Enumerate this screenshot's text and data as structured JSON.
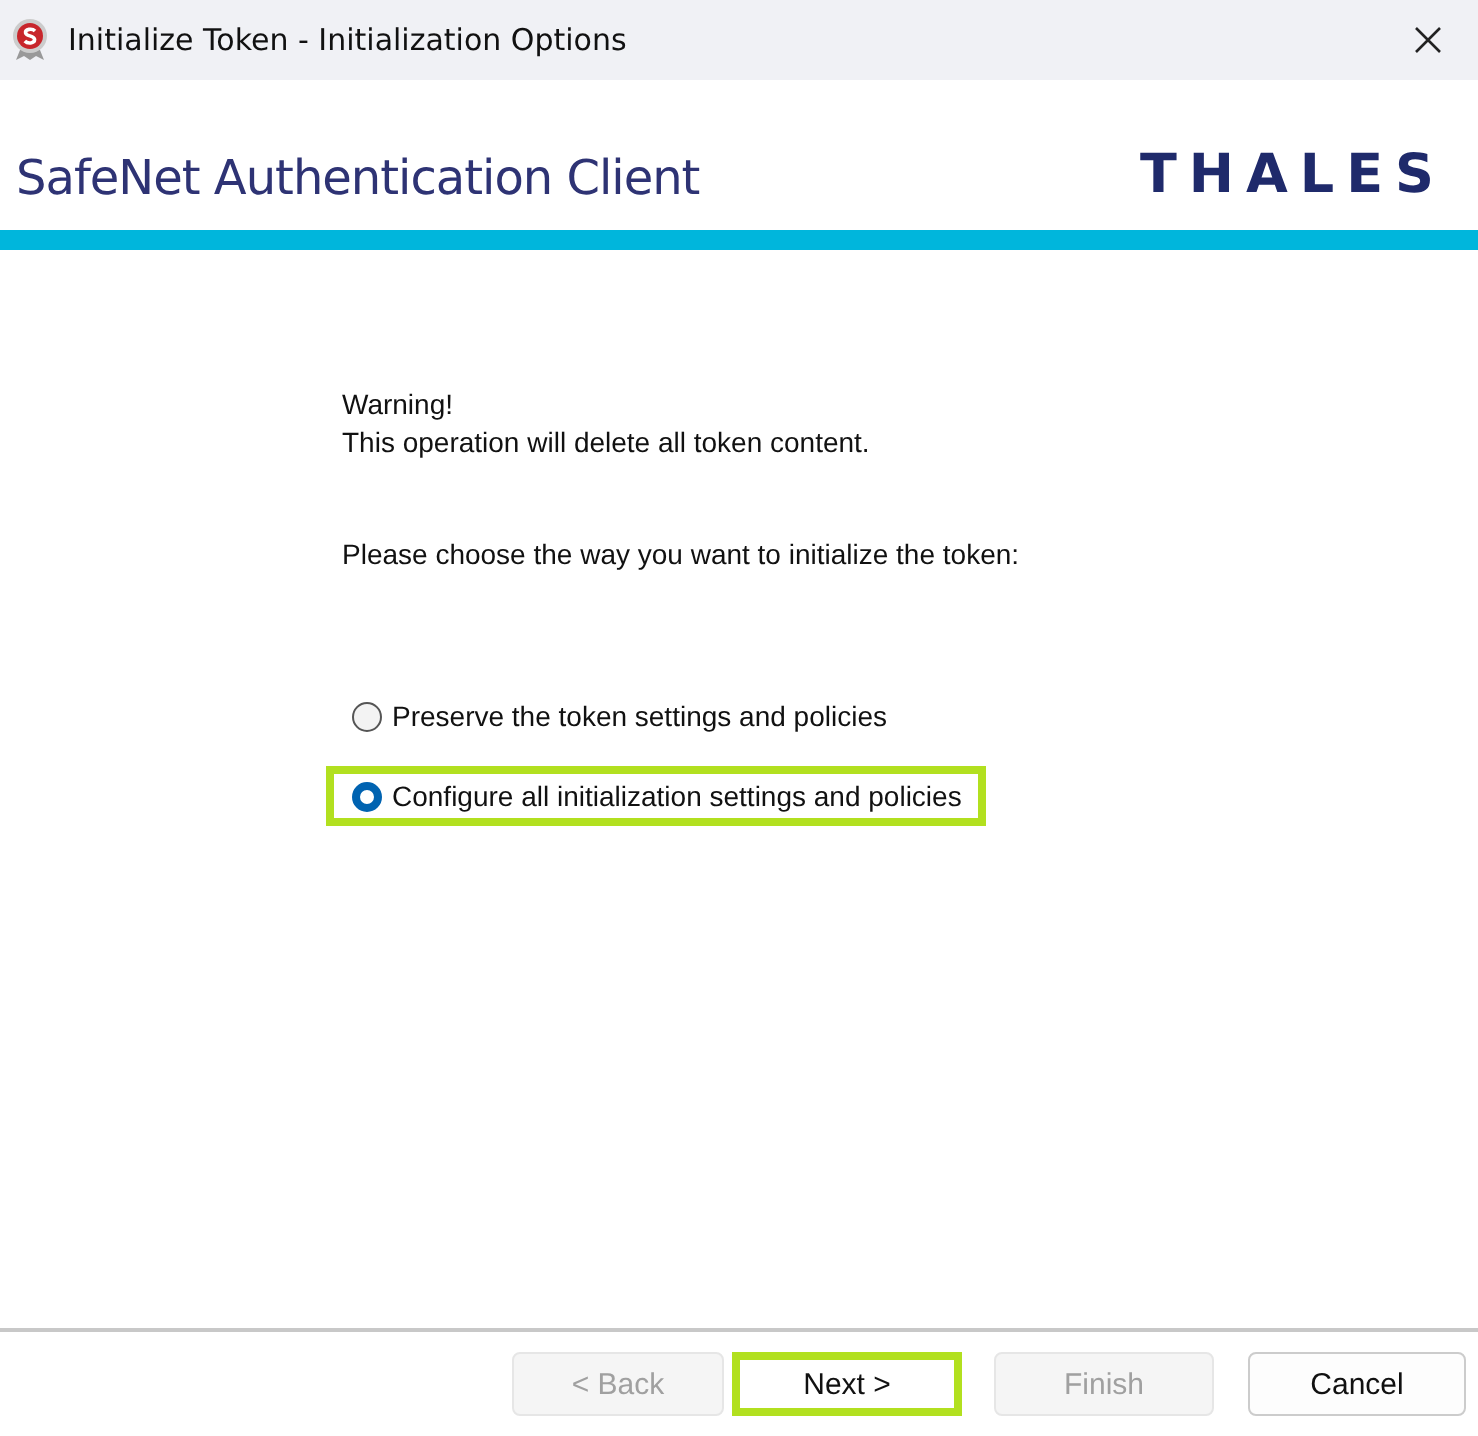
{
  "window": {
    "title": "Initialize Token - Initialization Options"
  },
  "header": {
    "product": "SafeNet Authentication Client",
    "brand": "THALES"
  },
  "message": {
    "lines": [
      "Warning!",
      "This operation will delete all token content."
    ],
    "prompt": "Please choose the way you want to initialize the token:"
  },
  "options": [
    {
      "label": "Preserve the token settings and policies",
      "selected": false,
      "highlighted": false
    },
    {
      "label": "Configure all initialization settings and policies",
      "selected": true,
      "highlighted": true
    }
  ],
  "buttons": [
    {
      "label": "< Back",
      "disabled": true,
      "highlighted": false
    },
    {
      "label": "Next >",
      "disabled": false,
      "highlighted": true
    },
    {
      "label": "Finish",
      "disabled": true,
      "highlighted": false
    },
    {
      "label": "Cancel",
      "disabled": false,
      "highlighted": false
    }
  ]
}
